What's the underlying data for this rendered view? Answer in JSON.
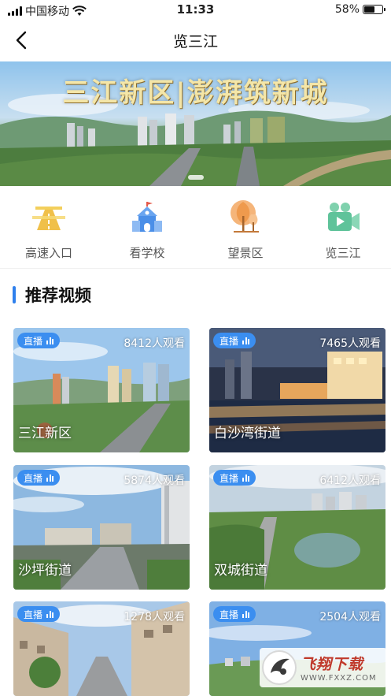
{
  "status": {
    "carrier": "中国移动",
    "time": "11:33",
    "battery_text": "58%",
    "battery_level": 0.58
  },
  "nav": {
    "title": "览三江",
    "back_icon": "back-arrow-icon"
  },
  "banner": {
    "title": "三江新区|澎湃筑新城"
  },
  "shortcuts": [
    {
      "label": "高速入口",
      "icon": "highway-icon",
      "color": "#f0c04a"
    },
    {
      "label": "看学校",
      "icon": "school-icon",
      "color": "#4b8fe8"
    },
    {
      "label": "望景区",
      "icon": "tree-icon",
      "color": "#ef9a4d"
    },
    {
      "label": "览三江",
      "icon": "video-camera-icon",
      "color": "#5fc39a"
    }
  ],
  "section": {
    "title": "推荐视频"
  },
  "videos": [
    {
      "badge": "直播",
      "views": "8412人观看",
      "title": "三江新区"
    },
    {
      "badge": "直播",
      "views": "7465人观看",
      "title": "白沙湾街道"
    },
    {
      "badge": "直播",
      "views": "5874人观看",
      "title": "沙坪街道"
    },
    {
      "badge": "直播",
      "views": "6412人观看",
      "title": "双城街道"
    },
    {
      "badge": "直播",
      "views": "1278人观看",
      "title": ""
    },
    {
      "badge": "直播",
      "views": "2504人观看",
      "title": ""
    }
  ],
  "watermark": {
    "main": "飞翔下载",
    "url": "WWW.FXXZ.COM"
  },
  "colors": {
    "accent": "#2f80ed",
    "badge": "#3b8ef0"
  }
}
